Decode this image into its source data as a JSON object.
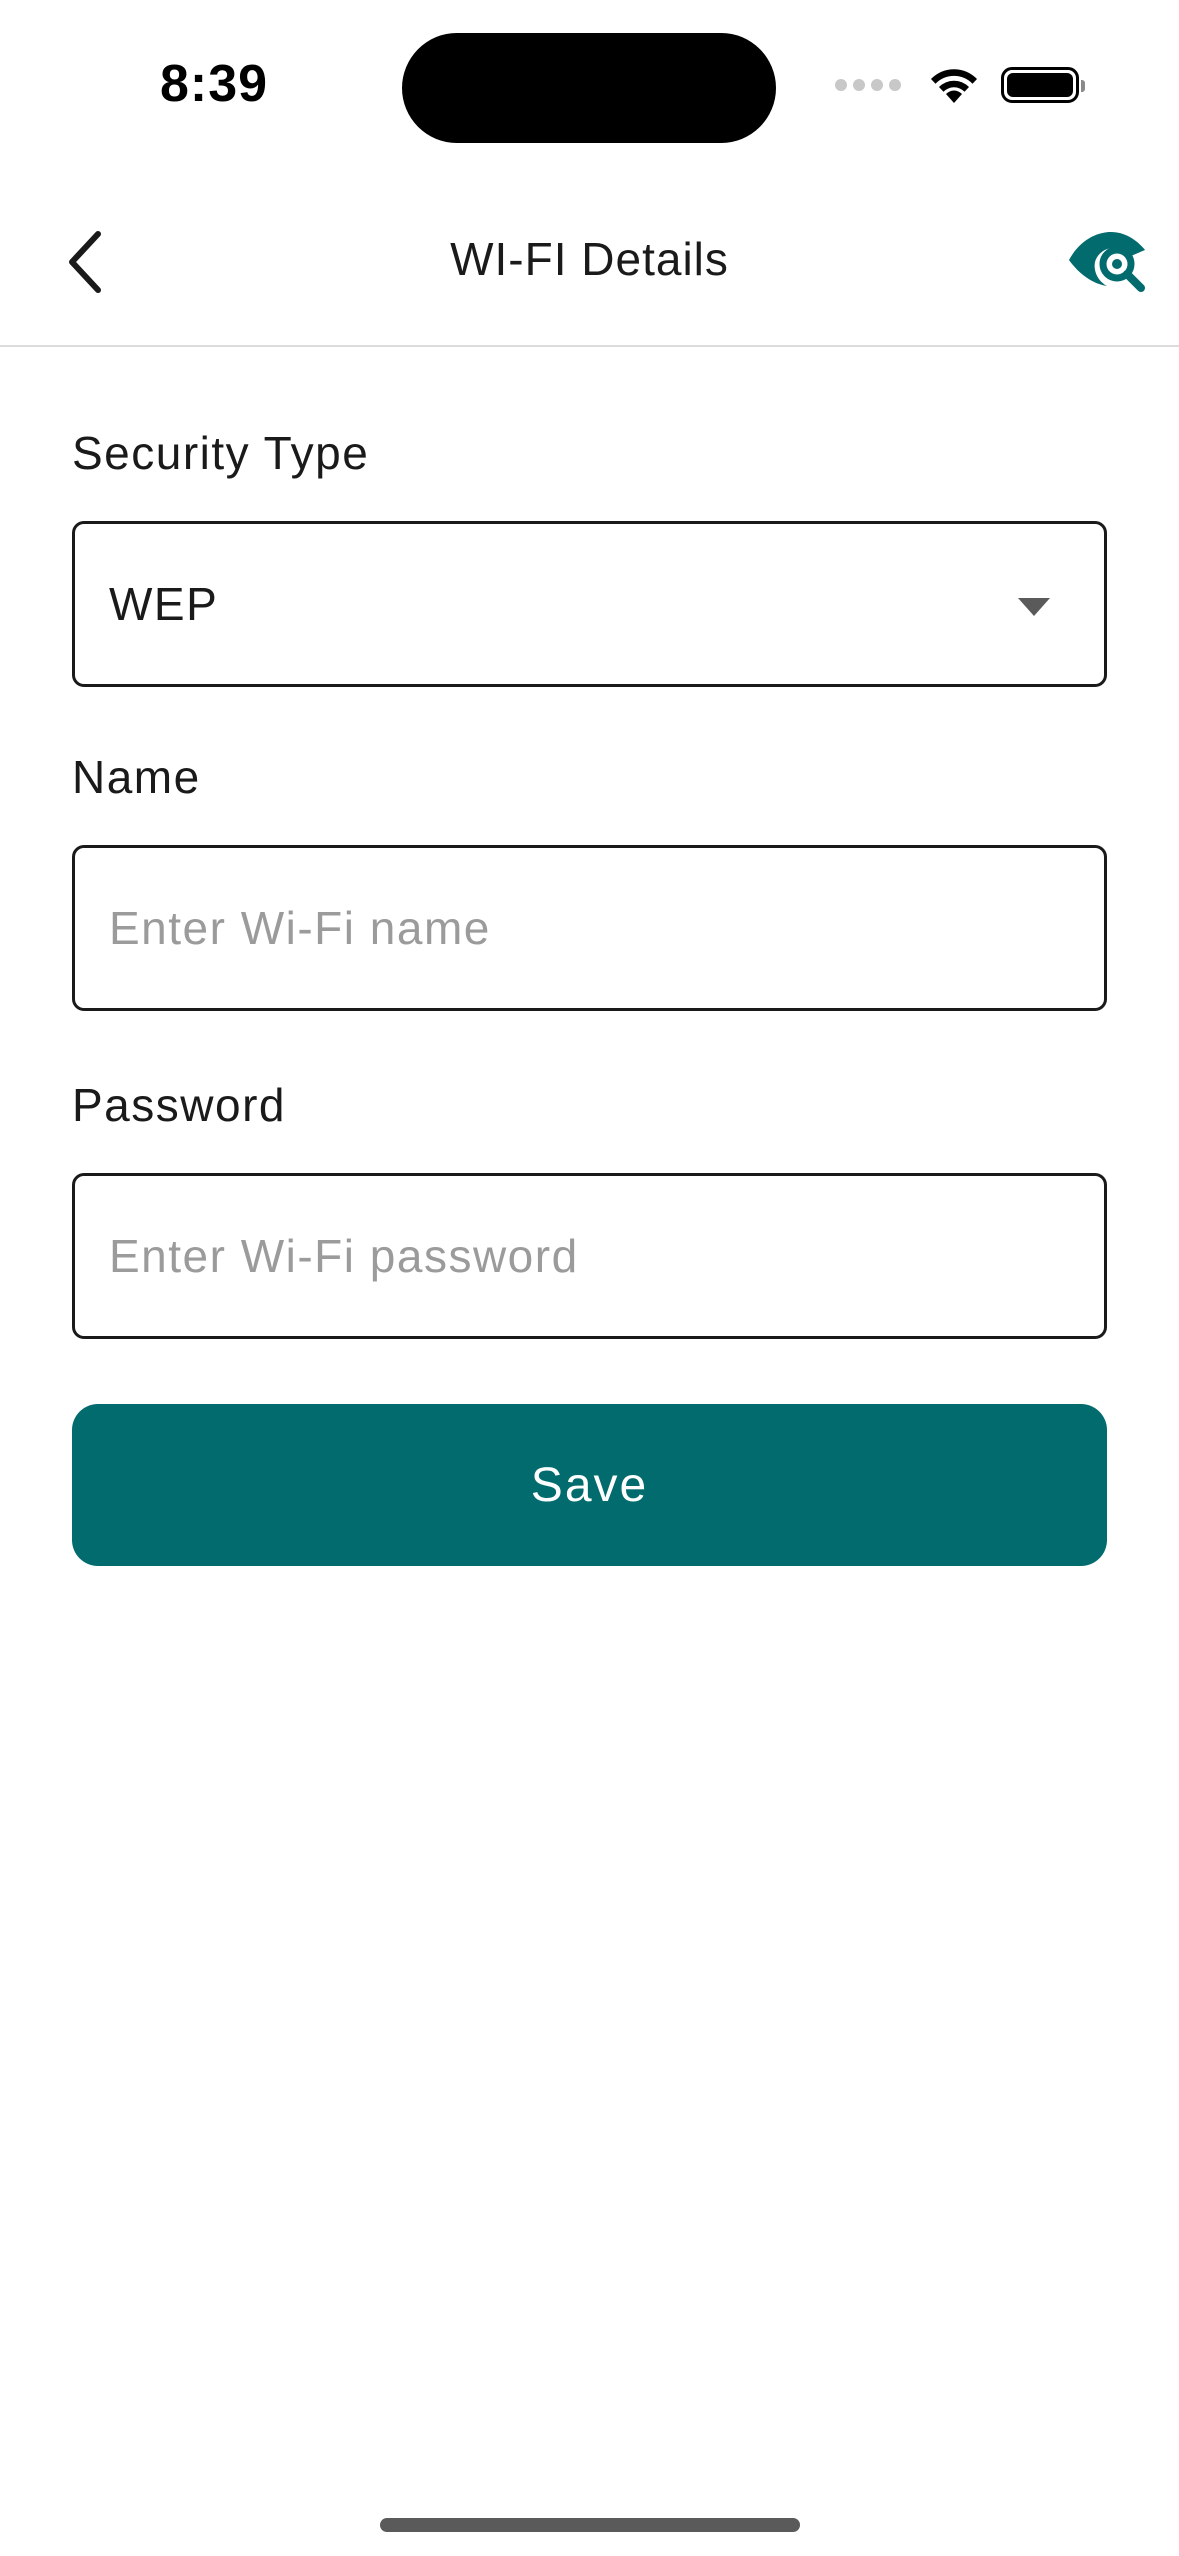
{
  "status_bar": {
    "time": "8:39"
  },
  "nav": {
    "title": "WI-FI Details",
    "back_icon": "chevron-left-icon",
    "right_icon": "eye-search-icon"
  },
  "form": {
    "security_type": {
      "label": "Security Type",
      "value": "WEP"
    },
    "name": {
      "label": "Name",
      "placeholder": "Enter Wi-Fi name",
      "value": ""
    },
    "password": {
      "label": "Password",
      "placeholder": "Enter Wi-Fi password",
      "value": ""
    }
  },
  "actions": {
    "save_label": "Save"
  },
  "colors": {
    "accent": "#026b6e",
    "text": "#1a1a1a",
    "placeholder": "#9b9b9b",
    "divider": "#dcdcdc"
  }
}
